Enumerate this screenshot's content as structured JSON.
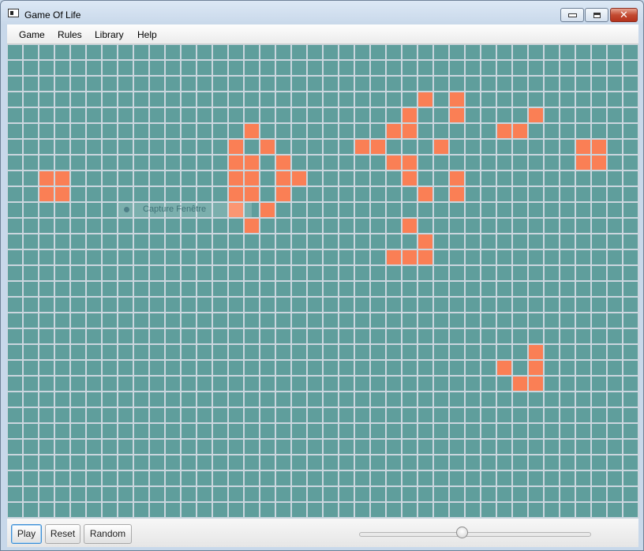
{
  "window": {
    "title": "Game Of Life"
  },
  "menu": [
    {
      "label": "Game"
    },
    {
      "label": "Rules"
    },
    {
      "label": "Library"
    },
    {
      "label": "Help"
    }
  ],
  "board": {
    "columns": 40,
    "rows": 30,
    "dead_color": "#5f9e9c",
    "alive_color": "#fa7f55",
    "grid_line_color": "#cad6de",
    "live_cells": [
      [
        26,
        3
      ],
      [
        28,
        3
      ],
      [
        25,
        4
      ],
      [
        28,
        4
      ],
      [
        33,
        4
      ],
      [
        15,
        5
      ],
      [
        24,
        5
      ],
      [
        25,
        5
      ],
      [
        31,
        5
      ],
      [
        32,
        5
      ],
      [
        14,
        6
      ],
      [
        16,
        6
      ],
      [
        22,
        6
      ],
      [
        23,
        6
      ],
      [
        27,
        6
      ],
      [
        36,
        6
      ],
      [
        37,
        6
      ],
      [
        14,
        7
      ],
      [
        15,
        7
      ],
      [
        17,
        7
      ],
      [
        24,
        7
      ],
      [
        25,
        7
      ],
      [
        36,
        7
      ],
      [
        37,
        7
      ],
      [
        2,
        8
      ],
      [
        3,
        8
      ],
      [
        14,
        8
      ],
      [
        15,
        8
      ],
      [
        17,
        8
      ],
      [
        18,
        8
      ],
      [
        25,
        8
      ],
      [
        28,
        8
      ],
      [
        2,
        9
      ],
      [
        3,
        9
      ],
      [
        14,
        9
      ],
      [
        15,
        9
      ],
      [
        17,
        9
      ],
      [
        26,
        9
      ],
      [
        28,
        9
      ],
      [
        14,
        10
      ],
      [
        16,
        10
      ],
      [
        15,
        11
      ],
      [
        25,
        11
      ],
      [
        26,
        12
      ],
      [
        24,
        13
      ],
      [
        25,
        13
      ],
      [
        26,
        13
      ],
      [
        33,
        19
      ],
      [
        31,
        20
      ],
      [
        33,
        20
      ],
      [
        32,
        21
      ],
      [
        33,
        21
      ]
    ]
  },
  "overlay": {
    "text": "Capture Fenêtre"
  },
  "controls": {
    "play_label": "Play",
    "reset_label": "Reset",
    "random_label": "Random",
    "speed_slider_value": 0.45
  }
}
